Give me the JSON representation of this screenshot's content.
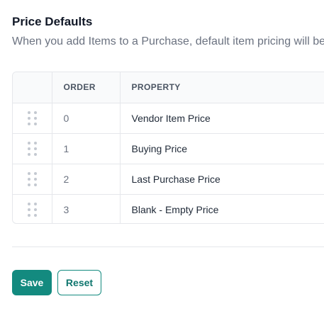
{
  "section": {
    "title": "Price Defaults",
    "description": "When you add Items to a Purchase, default item pricing will be"
  },
  "table": {
    "columns": [
      "ORDER",
      "PROPERTY"
    ],
    "rows": [
      {
        "order": "0",
        "property": "Vendor Item Price"
      },
      {
        "order": "1",
        "property": "Buying Price"
      },
      {
        "order": "2",
        "property": "Last Purchase Price"
      },
      {
        "order": "3",
        "property": "Blank - Empty Price"
      }
    ]
  },
  "actions": {
    "save_label": "Save",
    "reset_label": "Reset"
  },
  "colors": {
    "primary": "#138a7f",
    "border": "#e5e7eb",
    "header_bg": "#f9fafb",
    "muted_text": "#6b7280"
  },
  "icons": {
    "row_handle": "drag-handle-icon"
  }
}
